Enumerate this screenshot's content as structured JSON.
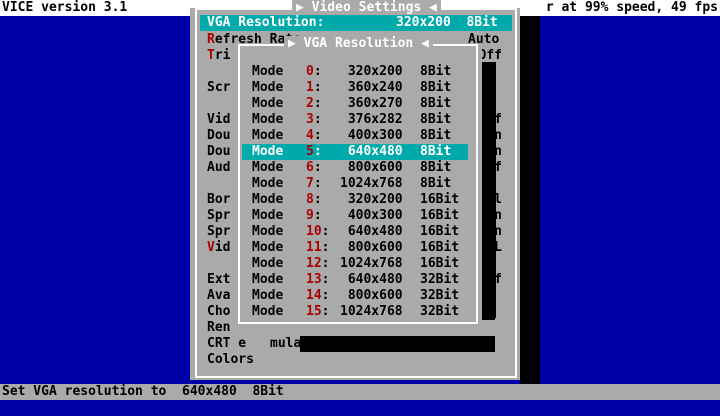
{
  "topbar": {
    "app_title": "VICE version 3.1",
    "speed": "r at 99% speed, 49 fps"
  },
  "video_settings": {
    "title": "Video Settings",
    "selected_label": "VGA Resolution:",
    "selected_value": "320x200  8Bit",
    "rows": [
      {
        "hot": "R",
        "rest": "efresh Rate:",
        "value": "Auto"
      },
      {
        "hot": "T",
        "rest": "ri",
        "value": "Off"
      },
      {
        "hot": "",
        "rest": "",
        "value": ""
      },
      {
        "hot": "",
        "rest": "Scr",
        "value": ""
      },
      {
        "hot": "",
        "rest": "",
        "value": ""
      },
      {
        "hot": "",
        "rest": "Vid",
        "value": "Off"
      },
      {
        "hot": "",
        "rest": "Dou",
        "value": "On"
      },
      {
        "hot": "",
        "rest": "Dou",
        "value": "On"
      },
      {
        "hot": "",
        "rest": "Aud",
        "value": "Off"
      },
      {
        "hot": "",
        "rest": "",
        "value": ""
      },
      {
        "hot": "",
        "rest": "Bor",
        "value": "mal"
      },
      {
        "hot": "",
        "rest": "Spr",
        "value": "On"
      },
      {
        "hot": "",
        "rest": "Spr",
        "value": "On"
      },
      {
        "hot": "V",
        "rest": "id",
        "value": "PAL"
      },
      {
        "hot": "",
        "rest": "",
        "value": ""
      },
      {
        "hot": "",
        "rest": "Ext",
        "value": "Off"
      },
      {
        "hot": "",
        "rest": "Ava",
        "value": ""
      },
      {
        "hot": "",
        "rest": "Cho",
        "value": ""
      },
      {
        "hot": "",
        "rest": "Ren",
        "value": ""
      },
      {
        "hot": "",
        "rest": "CRT e",
        "value": "mulation"
      },
      {
        "hot": "",
        "rest": "Colors",
        "value": ""
      }
    ]
  },
  "vga_resolution": {
    "title": "VGA Resolution",
    "selected_index": 5,
    "modes": [
      {
        "label": "Mode",
        "num": "0",
        "res": " 320x200",
        "depth": "8Bit"
      },
      {
        "label": "Mode",
        "num": "1",
        "res": " 360x240",
        "depth": "8Bit"
      },
      {
        "label": "Mode",
        "num": "2",
        "res": " 360x270",
        "depth": "8Bit"
      },
      {
        "label": "Mode",
        "num": "3",
        "res": " 376x282",
        "depth": "8Bit"
      },
      {
        "label": "Mode",
        "num": "4",
        "res": " 400x300",
        "depth": "8Bit"
      },
      {
        "label": "Mode",
        "num": "5",
        "res": " 640x480",
        "depth": "8Bit"
      },
      {
        "label": "Mode",
        "num": "6",
        "res": " 800x600",
        "depth": "8Bit"
      },
      {
        "label": "Mode",
        "num": "7",
        "res": "1024x768",
        "depth": "8Bit"
      },
      {
        "label": "Mode",
        "num": "8",
        "res": " 320x200",
        "depth": "16Bit"
      },
      {
        "label": "Mode",
        "num": "9",
        "res": " 400x300",
        "depth": "16Bit"
      },
      {
        "label": "Mode",
        "num": "10",
        "res": " 640x480",
        "depth": "16Bit"
      },
      {
        "label": "Mode",
        "num": "11",
        "res": " 800x600",
        "depth": "16Bit"
      },
      {
        "label": "Mode",
        "num": "12",
        "res": "1024x768",
        "depth": "16Bit"
      },
      {
        "label": "Mode",
        "num": "13",
        "res": " 640x480",
        "depth": "32Bit"
      },
      {
        "label": "Mode",
        "num": "14",
        "res": " 800x600",
        "depth": "32Bit"
      },
      {
        "label": "Mode",
        "num": "15",
        "res": "1024x768",
        "depth": "32Bit"
      }
    ]
  },
  "statusbar": {
    "text": "Set VGA resolution to  640x480  8Bit"
  },
  "colors": {
    "background": "#0000aa",
    "dialog": "#aaaaaa",
    "selection": "#00aaaa",
    "hotkey": "#aa0000"
  }
}
